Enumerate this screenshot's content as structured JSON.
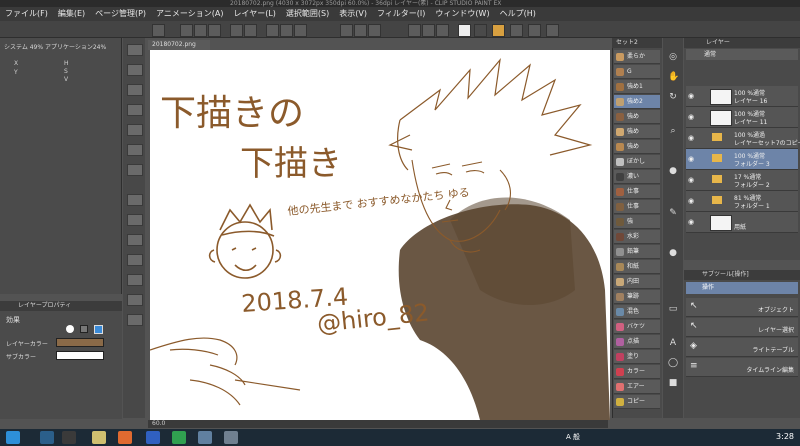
{
  "window": {
    "title": "20180702.png (4030 x 3072px 350dpi 60.0%)  - 36dpi レイヤー(素)  - CLIP STUDIO PAINT EX"
  },
  "menu": [
    "ファイル(F)",
    "編集(E)",
    "ページ管理(P)",
    "アニメーション(A)",
    "レイヤー(L)",
    "選択範囲(S)",
    "表示(V)",
    "フィルター(I)",
    "ウィンドウ(W)",
    "ヘルプ(H)"
  ],
  "left_panel": {
    "header": "システム 49%  アプリケーション24%",
    "labels": [
      "X",
      "Y",
      "H",
      "S",
      "V"
    ]
  },
  "layer_property": {
    "title": "レイヤープロパティ",
    "effect_label": "効果",
    "layer_color_label": "レイヤーカラー",
    "sub_color_label": "サブカラー",
    "layer_color": "#8a6a48",
    "sub_color": "#ffffff"
  },
  "document": {
    "tab": "20180702.png",
    "zoom": "60.0"
  },
  "artwork": {
    "line1": "下描きの",
    "line2": "下描き",
    "note": "他の先生まで おすすめなかたち ゆる",
    "date": "2018.7.4",
    "handle": "@hiro_82",
    "ink_color": "#8b5a2b",
    "wash_color": "#5a4530"
  },
  "subtool": {
    "header": "セット2",
    "items": [
      {
        "label": "柔らか",
        "color": "#c99a60"
      },
      {
        "label": "G",
        "color": "#b08050"
      },
      {
        "label": "強め1",
        "color": "#a07040"
      },
      {
        "label": "強め2",
        "color": "#c0a070"
      },
      {
        "label": "強め",
        "color": "#8a6040"
      },
      {
        "label": "強め",
        "color": "#d0a870"
      },
      {
        "label": "強め",
        "color": "#b88850"
      },
      {
        "label": "ぼかし",
        "color": "#c0c0c0"
      },
      {
        "label": "濃い",
        "color": "#404040"
      },
      {
        "label": "仕事",
        "color": "#a06040"
      },
      {
        "label": "仕事",
        "color": "#806040"
      },
      {
        "label": "強",
        "color": "#6f5a3c"
      },
      {
        "label": "水彩",
        "color": "#704838"
      },
      {
        "label": "鉛筆",
        "color": "#909090"
      },
      {
        "label": "和紙",
        "color": "#a88858"
      },
      {
        "label": "内田",
        "color": "#c8a878"
      },
      {
        "label": "筆跡",
        "color": "#a08060"
      },
      {
        "label": "混色",
        "color": "#6a8aa8"
      },
      {
        "label": "バケツ",
        "color": "#d06080"
      },
      {
        "label": "点描",
        "color": "#b060a0"
      },
      {
        "label": "塗り",
        "color": "#c04060"
      },
      {
        "label": "カラー",
        "color": "#d04050"
      },
      {
        "label": "エアー",
        "color": "#e07070"
      },
      {
        "label": "コピー",
        "color": "#d0b040"
      }
    ],
    "selected_index": 3
  },
  "layers": {
    "tab": "レイヤー",
    "blend": "通常",
    "rows": [
      {
        "l1": "100 %通常",
        "l2": "レイヤー 16",
        "type": "layer",
        "selected": false
      },
      {
        "l1": "100 %通常",
        "l2": "レイヤー 11",
        "type": "layer",
        "selected": false
      },
      {
        "l1": "100 %通過",
        "l2": "レイヤーセット7のコピー",
        "type": "folder",
        "selected": false
      },
      {
        "l1": "100 %通常",
        "l2": "フォルダー 3",
        "type": "folder",
        "selected": true
      },
      {
        "l1": "17 %通常",
        "l2": "フォルダー 2",
        "type": "folder",
        "selected": false
      },
      {
        "l1": "81 %通常",
        "l2": "フォルダー 1",
        "type": "folder",
        "selected": false
      },
      {
        "l1": "",
        "l2": "用紙",
        "type": "paper",
        "selected": false
      }
    ]
  },
  "subpanel": {
    "tab": "サブツール[操作]",
    "header": "操作",
    "items": [
      "オブジェクト",
      "レイヤー選択",
      "ライトテーブル",
      "タイムライン編集"
    ]
  },
  "taskbar": {
    "time": "3:28",
    "ime": "A 般"
  }
}
